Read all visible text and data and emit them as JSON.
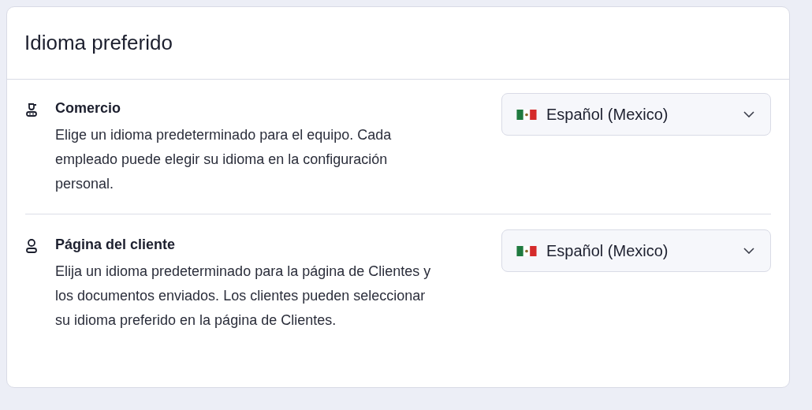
{
  "card": {
    "title": "Idioma preferido"
  },
  "settings": [
    {
      "kind": "staff",
      "label": "Comercio",
      "description": "Elige un idioma predeterminado para el equipo. Cada empleado puede elegir su idioma en la configuración personal.",
      "select": {
        "value": "Español (Mexico)"
      }
    },
    {
      "kind": "customer",
      "label": "Página del cliente",
      "description": "Elija un idioma predeterminado para la página de Clientes y los documentos enviados. Los clientes pueden seleccionar su idioma preferido en la página de Clientes.",
      "select": {
        "value": "Español (Mexico)"
      }
    }
  ]
}
